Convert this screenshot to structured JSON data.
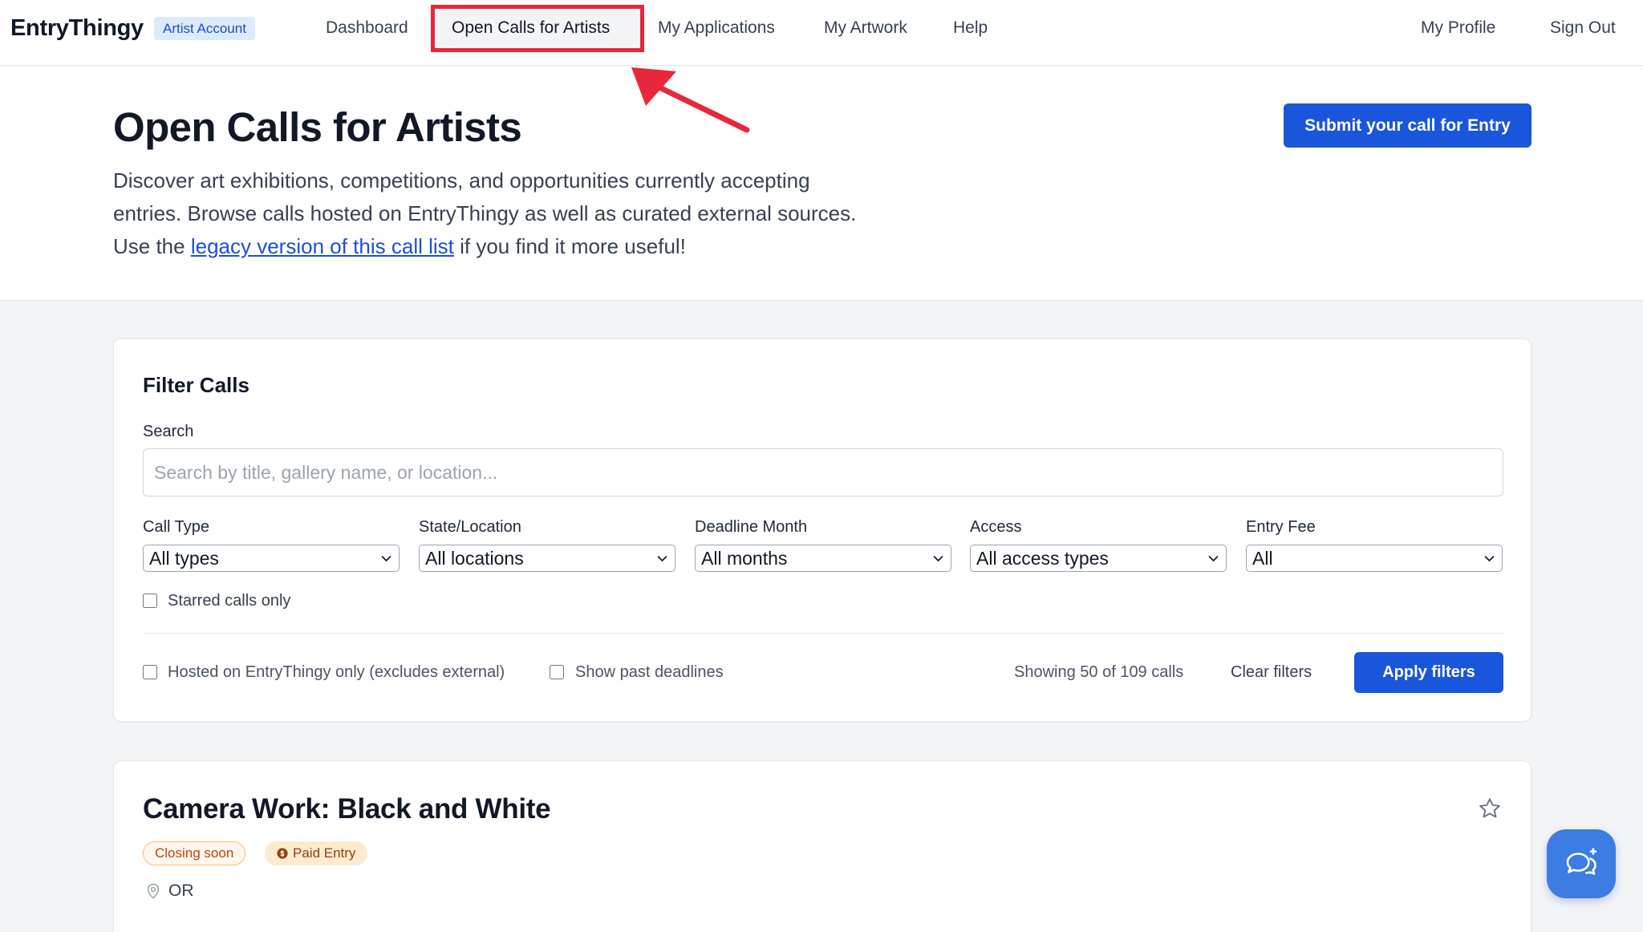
{
  "brand": {
    "name": "EntryThingy",
    "account_badge": "Artist Account"
  },
  "nav": {
    "items": [
      {
        "label": "Dashboard",
        "active": false
      },
      {
        "label": "Open Calls for Artists",
        "active": true
      },
      {
        "label": "My Applications",
        "active": false
      },
      {
        "label": "My Artwork",
        "active": false
      },
      {
        "label": "Help",
        "active": false
      }
    ],
    "account_links": [
      {
        "label": "My Profile"
      },
      {
        "label": "Sign Out"
      }
    ]
  },
  "header": {
    "title": "Open Calls for Artists",
    "description_lines": [
      "Discover art exhibitions, competitions, and opportunities currently accepting",
      "entries. Browse calls hosted on EntryThingy as well as curated external sources."
    ],
    "legacy": {
      "prefix": "Use the",
      "link": "legacy version of this call list",
      "suffix": "if you find it more useful!"
    },
    "submit_button": "Submit your call for Entry"
  },
  "filters": {
    "heading": "Filter Calls",
    "search": {
      "label": "Search",
      "value": "",
      "placeholder": "Search by title, gallery name, or location..."
    },
    "selects": [
      {
        "label": "Call Type",
        "value": "All types"
      },
      {
        "label": "State/Location",
        "value": "All locations"
      },
      {
        "label": "Deadline Month",
        "value": "All months"
      },
      {
        "label": "Access",
        "value": "All access types"
      },
      {
        "label": "Entry Fee",
        "value": "All"
      }
    ],
    "starred_only": {
      "label": "Starred calls only",
      "checked": false
    },
    "hosted_only": {
      "label": "Hosted on EntryThingy only (excludes external)",
      "checked": false
    },
    "show_past": {
      "label": "Show past deadlines",
      "checked": false
    },
    "results_count": "Showing 50 of 109 calls",
    "clear_label": "Clear filters",
    "apply_label": "Apply filters"
  },
  "calls": [
    {
      "title": "Camera Work: Black and White",
      "starred": false,
      "star_icon": "star-outline-icon",
      "badges": [
        {
          "label": "Closing soon",
          "kind": "closing"
        },
        {
          "label": "Paid Entry",
          "kind": "paid",
          "icon": "currency-icon"
        }
      ],
      "location": "OR",
      "location_icon": "map-pin-icon"
    }
  ],
  "chat_widget": {
    "icon": "chat-bubbles-icon"
  },
  "colors": {
    "primary": "#1a56db",
    "link": "#1d4ed8",
    "annotation": "#e8273b",
    "page_background": "#f3f4f6",
    "badge_account_bg": "#dbeafe",
    "badge_closing": "#c2410c",
    "badge_paid": "#92400e",
    "chat_button": "#3b7de3"
  }
}
